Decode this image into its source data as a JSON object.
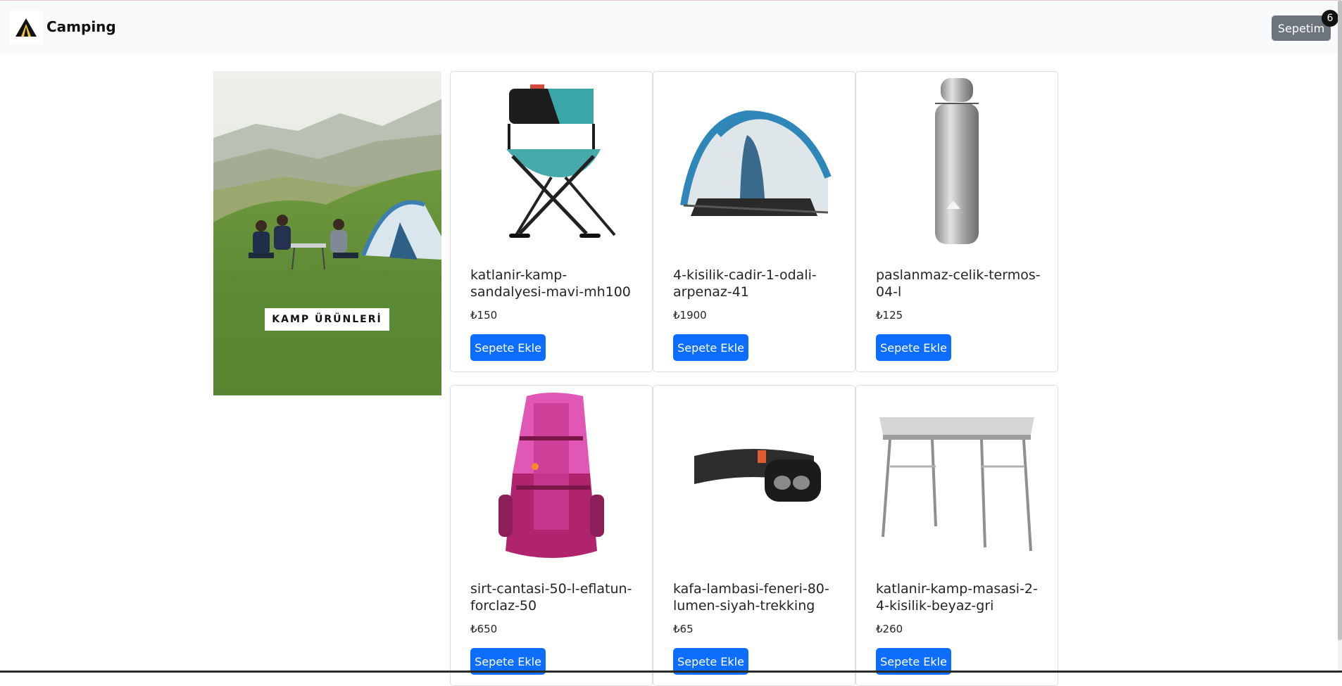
{
  "navbar": {
    "brand": "Camping",
    "cart_label": "Sepetim",
    "cart_count": "6"
  },
  "banner": {
    "label": "KAMP ÜRÜNLERİ"
  },
  "products": [
    {
      "name": "katlanir-kamp-sandalyesi-mavi-mh100",
      "price": "₺150",
      "button": "Sepete Ekle",
      "icon": "camp-chair-icon"
    },
    {
      "name": "4-kisilik-cadir-1-odali-arpenaz-41",
      "price": "₺1900",
      "button": "Sepete Ekle",
      "icon": "tent-icon"
    },
    {
      "name": "paslanmaz-celik-termos-04-l",
      "price": "₺125",
      "button": "Sepete Ekle",
      "icon": "thermos-icon"
    },
    {
      "name": "sirt-cantasi-50-l-eflatun-forclaz-50",
      "price": "₺650",
      "button": "Sepete Ekle",
      "icon": "backpack-icon"
    },
    {
      "name": "kafa-lambasi-feneri-80-lumen-siyah-trekking",
      "price": "₺65",
      "button": "Sepete Ekle",
      "icon": "headlamp-icon"
    },
    {
      "name": "katlanir-kamp-masasi-2-4-kisilik-beyaz-gri",
      "price": "₺260",
      "button": "Sepete Ekle",
      "icon": "camp-table-icon"
    }
  ],
  "colors": {
    "navbar_bg": "#f8f9fa",
    "primary": "#0d6efd",
    "secondary": "#6c757d"
  }
}
